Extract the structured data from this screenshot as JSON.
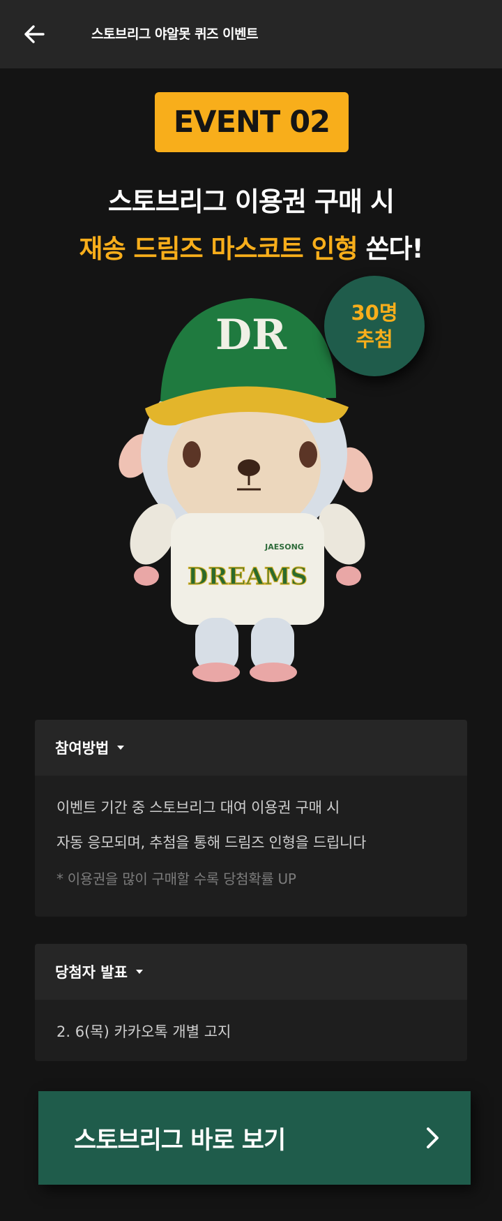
{
  "header": {
    "back_icon": "arrow-left-icon",
    "title": "스토브리그 야알못 퀴즈 이벤트"
  },
  "event": {
    "badge": "EVENT 02",
    "headline_line1": "스토브리그 이용권 구매 시",
    "headline_line2_accent": "재송 드림즈 마스코트 인형",
    "headline_line2_rest": " 쏜다!",
    "winners_count": "30명",
    "winners_label": "추첨",
    "accent_color": "#f8ae1b",
    "brand_green": "#1f5c4b",
    "mascot_jersey_text": "DREAMS",
    "mascot_jersey_small": "JAESONG",
    "mascot_cap_logo": "DR"
  },
  "how_to": {
    "title": "참여방법",
    "line1": "이벤트 기간 중 스토브리그 대여 이용권 구매 시",
    "line2": "자동 응모되며, 추첨을 통해 드림즈 인형을 드립니다",
    "note": "* 이용권을 많이 구매할 수록 당첨확률 UP"
  },
  "winners": {
    "title": "당첨자 발표",
    "detail": "2. 6(목) 카카오톡 개별 고지"
  },
  "cta": {
    "label": "스토브리그 바로 보기",
    "icon": "chevron-right-icon"
  }
}
